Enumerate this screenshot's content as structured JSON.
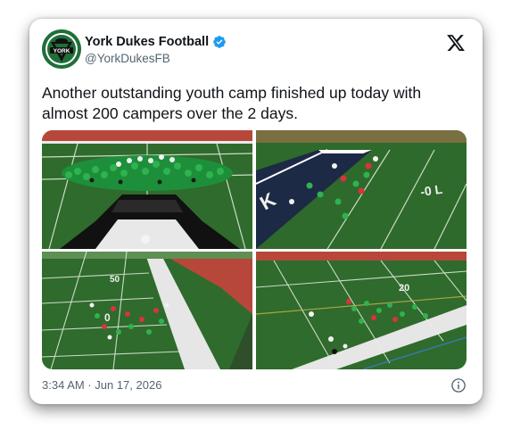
{
  "account": {
    "name": "York Dukes Football",
    "handle": "@YorkDukesFB",
    "logo_text": "YORK",
    "verified": true
  },
  "post": {
    "text": "Another outstanding youth camp finished up today with almost 200 campers over the 2 days.",
    "timestamp": "3:34 AM · Jun 17, 2026"
  },
  "media": {
    "count": 4,
    "items": [
      {
        "name": "group-photo-at-midfield-logo"
      },
      {
        "name": "drills-in-endzone"
      },
      {
        "name": "drills-near-sideline"
      },
      {
        "name": "drills-at-yard-line"
      }
    ]
  },
  "icons": {
    "brand": "x-logo-icon",
    "verified": "verified-badge-icon",
    "info": "info-icon"
  },
  "colors": {
    "verified_blue": "#1d9bf0",
    "text": "#0f1419",
    "secondary_text": "#536471",
    "turf": "#2f6b2c",
    "track": "#b8473b"
  }
}
